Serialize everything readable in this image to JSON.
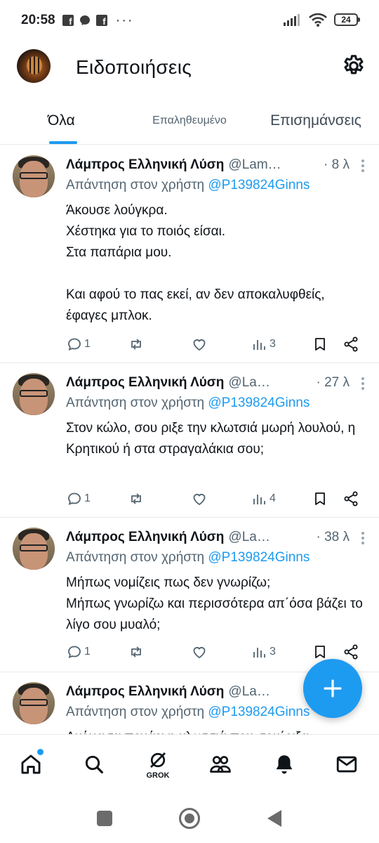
{
  "status_bar": {
    "time": "20:58",
    "battery": "24",
    "more": "···"
  },
  "header": {
    "title": "Ειδοποιήσεις"
  },
  "tabs": [
    {
      "label": "Όλα",
      "active": true
    },
    {
      "label": "Επαληθευμένο",
      "active": false
    },
    {
      "label": "Επισημάνσεις",
      "active": false
    }
  ],
  "posts": [
    {
      "name": "Λάμπρος Ελληνική Λύση",
      "handle": "@Lam…",
      "time": "· 8 λ",
      "reply_prefix": "Απάντηση στον χρήστη",
      "reply_to": "@P139824Ginns",
      "text": "Άκουσε λούγκρα.\nΧέστηκα για το ποιός είσαι.\nΣτα παπάρια μου.\n\nΚαι αφού το πας εκεί, αν δεν αποκαλυφθείς, έφαγες μπλοκ.",
      "replies": "1",
      "views": "3"
    },
    {
      "name": "Λάμπρος Ελληνική Λύση",
      "handle": "@La…",
      "time": "· 27 λ",
      "reply_prefix": "Απάντηση στον χρήστη",
      "reply_to": "@P139824Ginns",
      "text": "Στον κώλο, σου ριξε την κλωτσιά μωρή λουλού, η Κρητικού ή στα στραγαλάκια σου;",
      "replies": "1",
      "views": "4"
    },
    {
      "name": "Λάμπρος Ελληνική Λύση",
      "handle": "@La…",
      "time": "· 38 λ",
      "reply_prefix": "Απάντηση στον χρήστη",
      "reply_to": "@P139824Ginns",
      "text": "Μήπως νομίζεις πως δεν γνωρίζω;\nΜήπως γνωρίζω και περισσότερα απ΄όσα βάζει το λίγο σου μυαλό;",
      "replies": "1",
      "views": "3"
    },
    {
      "name": "Λάμπρος Ελληνική Λύση",
      "handle": "@La…",
      "time": "",
      "reply_prefix": "Απάντηση στον χρήστη",
      "reply_to": "@P139824Ginns",
      "text": "Ακόμα τα πονάει η κλωτσιά που σου΄ριξα",
      "replies": "",
      "views": ""
    }
  ],
  "bottom_nav": {
    "grok_label": "GROK"
  },
  "colors": {
    "accent": "#1d9bf0",
    "text": "#0f1419",
    "muted": "#536471"
  }
}
